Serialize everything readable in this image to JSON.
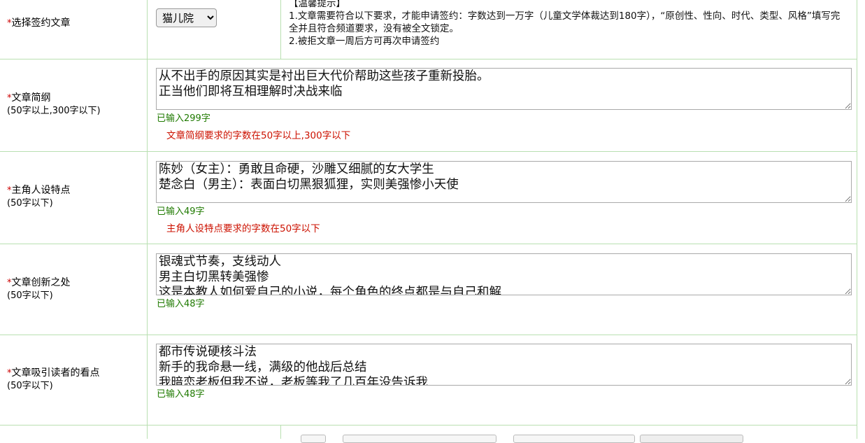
{
  "select_article": {
    "label": "选择签约文章",
    "required_mark": "*",
    "selected": "猫儿院",
    "options": [
      "猫儿院"
    ]
  },
  "tips": {
    "title": "【温馨提示】",
    "line1": "1.文章需要符合以下要求，才能申请签约：字数达到一万字（儿童文学体裁达到180字），“原创性、性向、时代、类型、风格”填写完全并且符合频道要求，没有被全文锁定。",
    "line2": "2.被拒文章一周后方可再次申请签约"
  },
  "summary": {
    "label": "文章简纲",
    "sub": "(50字以上,300字以下)",
    "required_mark": "*",
    "value": "从不出手的原因其实是衬出巨大代价帮助这些孩子重新投胎。\n正当他们即将互相理解时决战来临",
    "count": "已输入299字",
    "error": "文章简纲要求的字数在50字以上,300字以下"
  },
  "characters": {
    "label": "主角人设特点",
    "sub": "(50字以下)",
    "required_mark": "*",
    "value": "陈妙（女主）：勇敢且命硬，沙雕又细腻的女大学生\n楚念白（男主）：表面白切黑狠狐狸，实则美强惨小天使",
    "count": "已输入49字",
    "error": "主角人设特点要求的字数在50字以下"
  },
  "innovation": {
    "label": "文章创新之处",
    "sub": "(50字以下)",
    "required_mark": "*",
    "value": "银魂式节奏，支线动人\n男主白切黑转美强惨\n这是本教人如何爱自己的小说，每个角色的终点都是与自己和解",
    "count": "已输入48字"
  },
  "highlights": {
    "label": "文章吸引读者的看点",
    "sub": "(50字以下)",
    "required_mark": "*",
    "value": "都市传说硬核斗法\n新手的我命悬一线，满级的他战后总结\n我暗恋老板但我不说，老板等我了几百年没告诉我",
    "count": "已输入48字"
  }
}
